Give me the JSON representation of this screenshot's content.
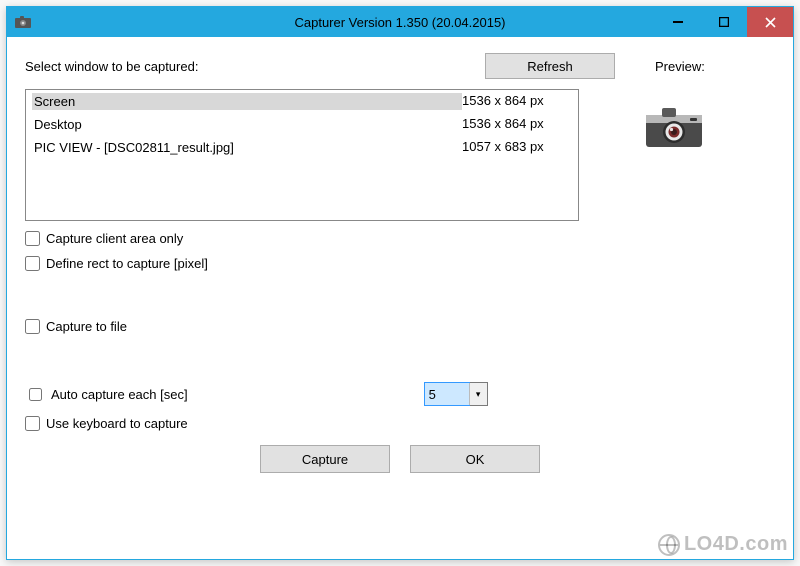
{
  "window": {
    "title": "Capturer Version 1.350 (20.04.2015)"
  },
  "labels": {
    "select_window": "Select window to be captured:",
    "preview": "Preview:",
    "refresh": "Refresh",
    "capture_client_only": "Capture client area only",
    "define_rect": "Define rect to capture [pixel]",
    "capture_to_file": "Capture to file",
    "auto_capture": "Auto capture each [sec]",
    "use_keyboard": "Use keyboard to capture",
    "capture": "Capture",
    "ok": "OK"
  },
  "windows_list": [
    {
      "name": "Screen",
      "size": "1536 x 864 px",
      "selected": true
    },
    {
      "name": "Desktop",
      "size": "1536 x 864 px",
      "selected": false
    },
    {
      "name": "PIC VIEW  - [DSC02811_result.jpg]",
      "size": "1057 x 683 px",
      "selected": false
    }
  ],
  "auto_capture_value": "5",
  "watermark": "LO4D.com"
}
